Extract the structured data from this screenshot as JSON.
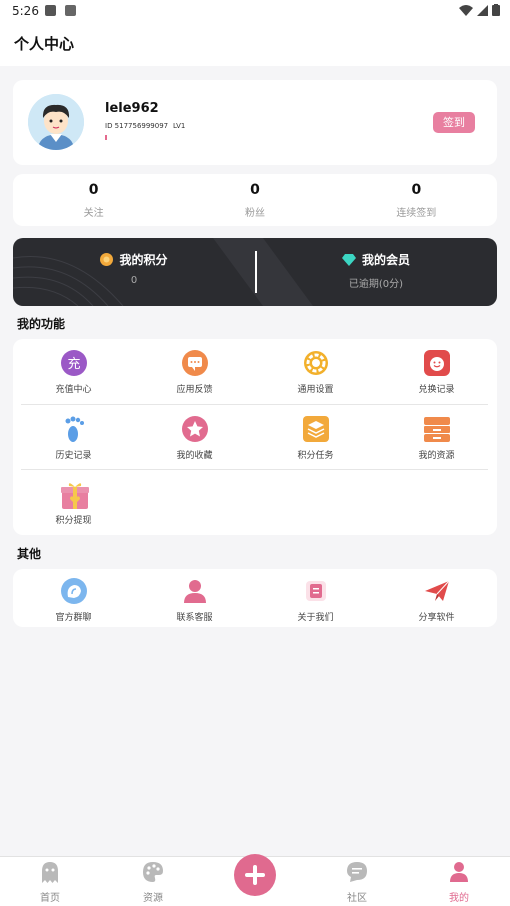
{
  "status_bar": {
    "time": "5:26"
  },
  "header": {
    "title": "个人中心"
  },
  "profile": {
    "username": "lele962",
    "id_text": "ID  517756999097",
    "level": "LV1",
    "signin_label": "签到"
  },
  "stats": [
    {
      "value": "0",
      "label": "关注"
    },
    {
      "value": "0",
      "label": "粉丝"
    },
    {
      "value": "0",
      "label": "连续签到"
    }
  ],
  "points": {
    "title": "我的积分",
    "value": "0"
  },
  "vip": {
    "title": "我的会员",
    "status": "已逾期(0分)"
  },
  "functions_section": {
    "title": "我的功能",
    "items": [
      {
        "label": "充值中心",
        "icon": "recharge-icon",
        "glyph": "充"
      },
      {
        "label": "应用反馈",
        "icon": "feedback-icon"
      },
      {
        "label": "通用设置",
        "icon": "gear-icon"
      },
      {
        "label": "兑换记录",
        "icon": "exchange-icon"
      },
      {
        "label": "历史记录",
        "icon": "footprint-icon"
      },
      {
        "label": "我的收藏",
        "icon": "star-icon"
      },
      {
        "label": "积分任务",
        "icon": "layers-icon"
      },
      {
        "label": "我的资源",
        "icon": "drawer-icon"
      },
      {
        "label": "积分提现",
        "icon": "gift-icon"
      }
    ]
  },
  "other_section": {
    "title": "其他",
    "items": [
      {
        "label": "官方群聊",
        "icon": "group-chat-icon"
      },
      {
        "label": "联系客服",
        "icon": "user-service-icon"
      },
      {
        "label": "关于我们",
        "icon": "about-icon"
      },
      {
        "label": "分享软件",
        "icon": "paper-plane-icon"
      }
    ]
  },
  "tabbar": [
    {
      "label": "首页",
      "icon": "ghost-icon"
    },
    {
      "label": "资源",
      "icon": "palette-icon"
    },
    {
      "label": "社区",
      "icon": "chat-bubble-icon"
    },
    {
      "label": "我的",
      "icon": "person-icon",
      "active": true
    }
  ],
  "colors": {
    "accent": "#e06a8f",
    "dark_card": "#2b2c30",
    "page_bg": "#f5f5f7"
  }
}
